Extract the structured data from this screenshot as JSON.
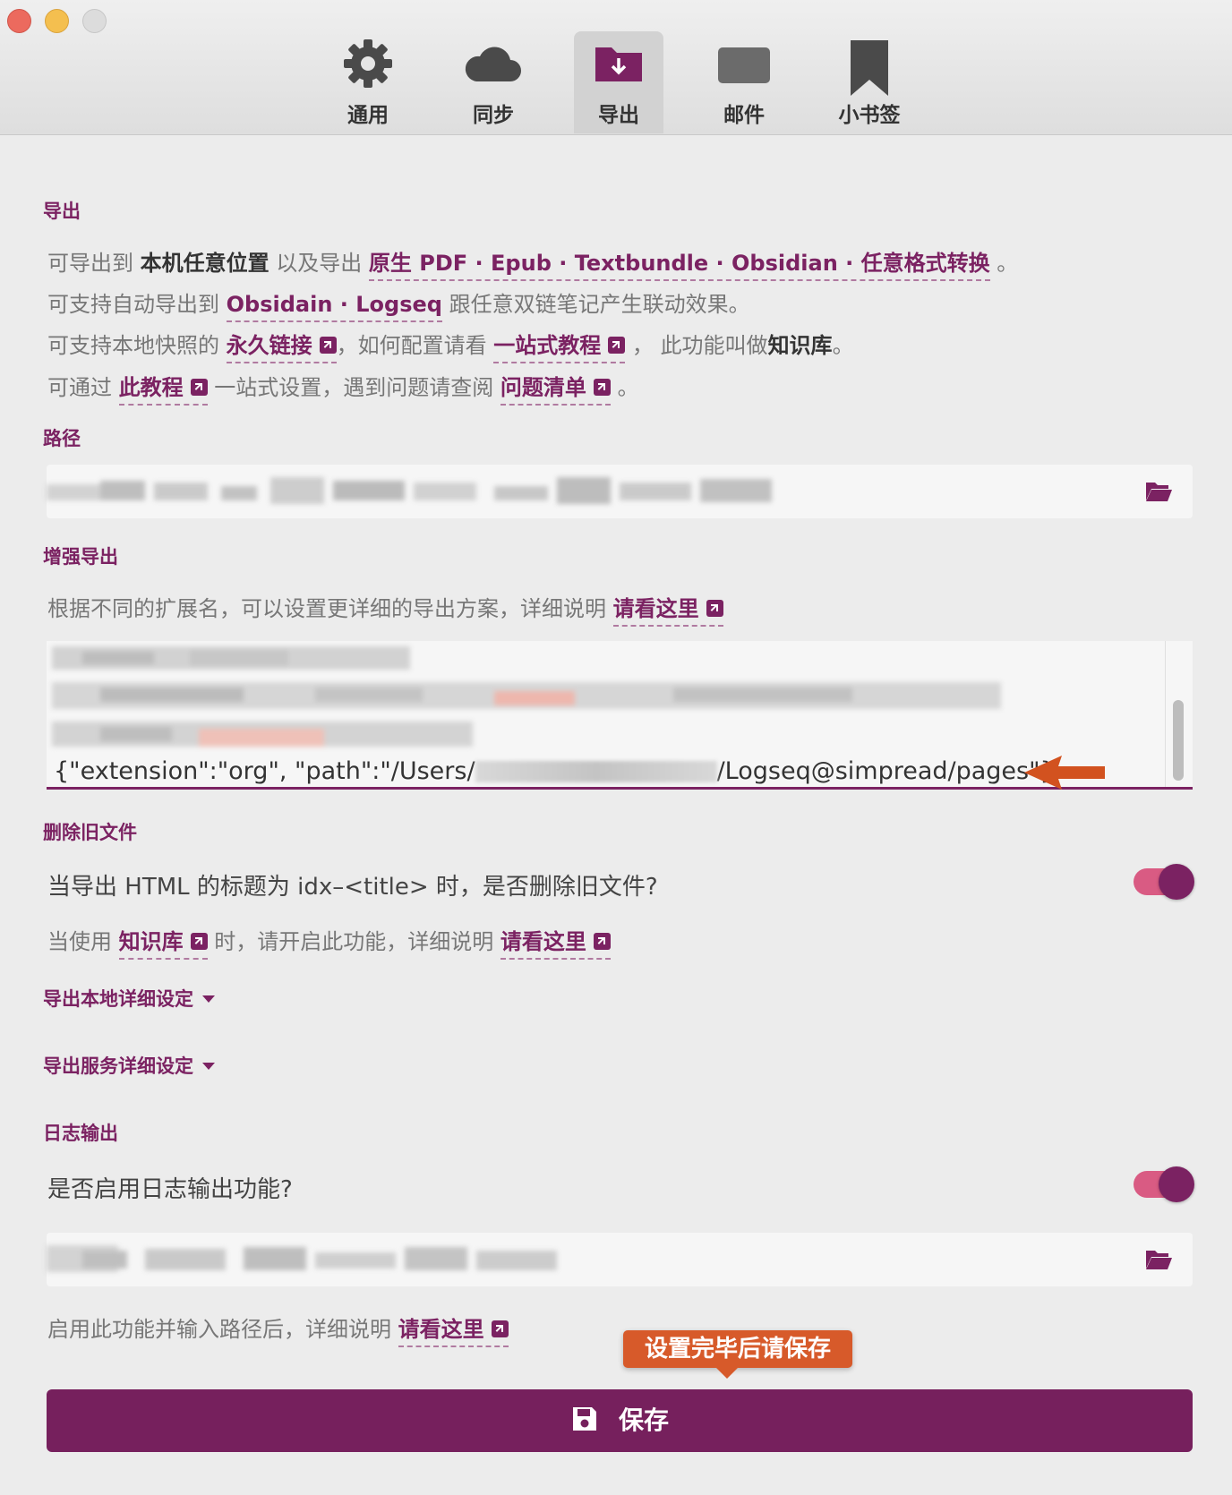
{
  "window": {
    "controls": [
      "close",
      "minimize",
      "zoom"
    ]
  },
  "tabs": [
    {
      "label": "通用",
      "icon": "gear-icon"
    },
    {
      "label": "同步",
      "icon": "cloud-icon"
    },
    {
      "label": "导出",
      "icon": "folder-download-icon",
      "active": true
    },
    {
      "label": "邮件",
      "icon": "mail-icon"
    },
    {
      "label": "小书签",
      "icon": "bookmark-icon"
    }
  ],
  "export": {
    "title": "导出",
    "l1": {
      "a": "可导出到",
      "b": "本机任意位置",
      "c": "以及导出",
      "d": "原生 PDF",
      "e": "Epub",
      "f": "Textbundle",
      "g": "Obsidian",
      "h": "任意格式转换",
      "dot": "·",
      "end": "。"
    },
    "l2": {
      "a": "可支持自动导出到",
      "b": "Obsidain",
      "c": "Logseq",
      "d": "跟任意双链笔记产生联动效果。",
      "dot": "·"
    },
    "l3": {
      "a": "可支持本地快照的",
      "b": "永久链接",
      "c": "，如何配置请看",
      "d": "一站式教程",
      "e": "，  此功能叫做",
      "f": "知识库",
      "g": "。"
    },
    "l4": {
      "a": "可通过",
      "b": "此教程",
      "c": "一站式设置，遇到问题请查阅",
      "d": "问题清单",
      "e": "。"
    }
  },
  "path": {
    "title": "路径",
    "value_redacted": true
  },
  "enhanced": {
    "title": "增强导出",
    "desc": "根据不同的扩展名，可以设置更详细的导出方案，详细说明",
    "link": "请看这里",
    "code_prefix": "{\"extension\":\"org\", \"path\":\"/Users/",
    "code_suffix": "/Logseq@simpread/pages\"}"
  },
  "delete_old": {
    "title": "删除旧文件",
    "question": "当导出 HTML 的标题为 idx–<title> 时，是否删除旧文件?",
    "enabled": true,
    "note_a": "当使用",
    "note_link1": "知识库",
    "note_b": "时，请开启此功能，详细说明",
    "note_link2": "请看这里"
  },
  "collapsibles": [
    {
      "label": "导出本地详细设定"
    },
    {
      "label": "导出服务详细设定"
    }
  ],
  "log": {
    "title": "日志输出",
    "question": "是否启用日志输出功能?",
    "enabled": true,
    "note": "启用此功能并输入路径后，详细说明",
    "link": "请看这里"
  },
  "tooltip": "设置完毕后请保存",
  "save": {
    "label": "保存"
  },
  "colors": {
    "accent": "#7b2262",
    "toggle_track": "#d95b83",
    "tooltip": "#d75a2a",
    "arrow": "#d2521f"
  }
}
